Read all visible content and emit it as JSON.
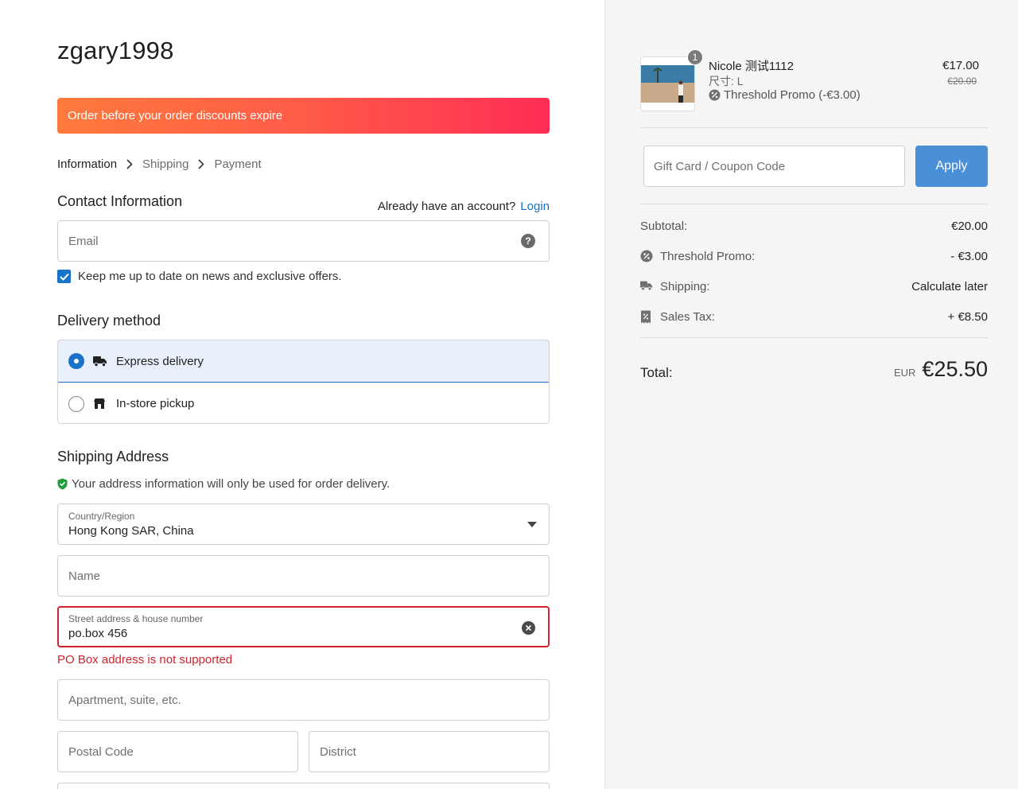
{
  "store": {
    "name": "zgary1998"
  },
  "banner": {
    "text": "Order before your order discounts expire"
  },
  "breadcrumb": {
    "step1": "Information",
    "step2": "Shipping",
    "step3": "Payment"
  },
  "contact": {
    "title": "Contact Information",
    "account_prompt": "Already have an account?",
    "login_label": "Login",
    "email_placeholder": "Email",
    "newsletter_label": "Keep me up to date on news and exclusive offers.",
    "newsletter_checked": true
  },
  "delivery": {
    "title": "Delivery method",
    "options": [
      {
        "label": "Express delivery",
        "selected": true,
        "icon": "truck-icon"
      },
      {
        "label": "In-store pickup",
        "selected": false,
        "icon": "store-icon"
      }
    ]
  },
  "shipping_address": {
    "title": "Shipping Address",
    "privacy_note": "Your address information will only be used for order delivery.",
    "country_label": "Country/Region",
    "country_value": "Hong Kong SAR, China",
    "name_placeholder": "Name",
    "street_label": "Street address & house number",
    "street_value": "po.box 456",
    "street_error": "PO Box address is not supported",
    "apartment_placeholder": "Apartment, suite, etc.",
    "postal_placeholder": "Postal Code",
    "district_placeholder": "District"
  },
  "cart": {
    "item": {
      "quantity": "1",
      "name": "Nicole 测试1112",
      "variant": "尺寸: L",
      "promo": "Threshold Promo (-€3.00)",
      "price": "€17.00",
      "original_price": "€20.00"
    },
    "coupon_placeholder": "Gift Card / Coupon Code",
    "apply_label": "Apply",
    "summary": {
      "subtotal_label": "Subtotal:",
      "subtotal_value": "€20.00",
      "promo_label": "Threshold Promo:",
      "promo_value": "- €3.00",
      "shipping_label": "Shipping:",
      "shipping_value": "Calculate later",
      "tax_label": "Sales Tax:",
      "tax_value": "+ €8.50"
    },
    "total_label": "Total:",
    "total_currency": "EUR",
    "total_value": "€25.50"
  },
  "colors": {
    "accent": "#1a73c8",
    "apply_button": "#4a90d9",
    "error": "#d0222f",
    "banner_start": "#ff7a3c",
    "banner_end": "#ff2d55"
  }
}
